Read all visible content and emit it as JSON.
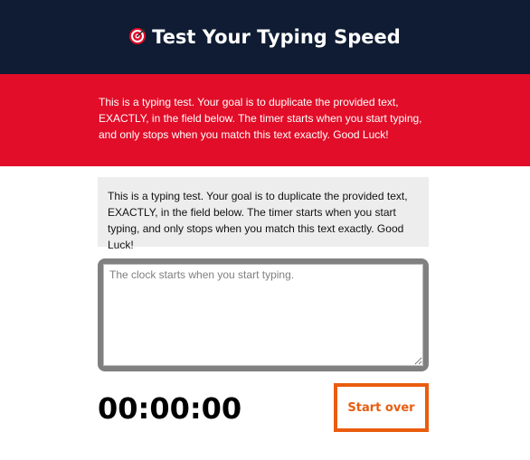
{
  "header": {
    "icon": "target-icon",
    "title": "Test Your Typing Speed"
  },
  "intro": {
    "text": "This is a typing test. Your goal is to duplicate the provided text, EXACTLY, in the field below. The timer starts when you start typing, and only stops when you match this text exactly. Good Luck!"
  },
  "test": {
    "origin_text": "This is a typing test. Your goal is to duplicate the provided text, EXACTLY, in the field below. The timer starts when you start typing, and only stops when you match this text exactly. Good Luck!",
    "input_value": "",
    "input_placeholder": "The clock starts when you start typing.",
    "timer": "00:00:00",
    "reset_label": "Start over"
  },
  "colors": {
    "header_bg": "#0f1c33",
    "intro_bg": "#e20d28",
    "origin_bg": "#ededed",
    "textarea_border": "#808080",
    "reset_accent": "#e95c0e"
  }
}
